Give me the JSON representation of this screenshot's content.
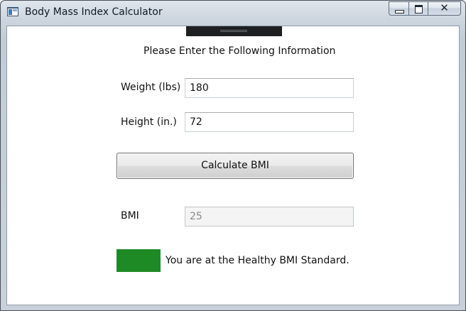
{
  "window": {
    "title": "Body Mass Index Calculator",
    "close_glyph": "✕"
  },
  "form": {
    "instructions": "Please Enter the Following Information",
    "weight_label": "Weight (lbs)",
    "weight_value": "180",
    "height_label": "Height (in.)",
    "height_value": "72",
    "calculate_label": "Calculate BMI",
    "bmi_label": "BMI",
    "bmi_value": "25"
  },
  "result": {
    "status_color": "#1e8a25",
    "status_text": "You are at the Healthy BMI Standard."
  }
}
